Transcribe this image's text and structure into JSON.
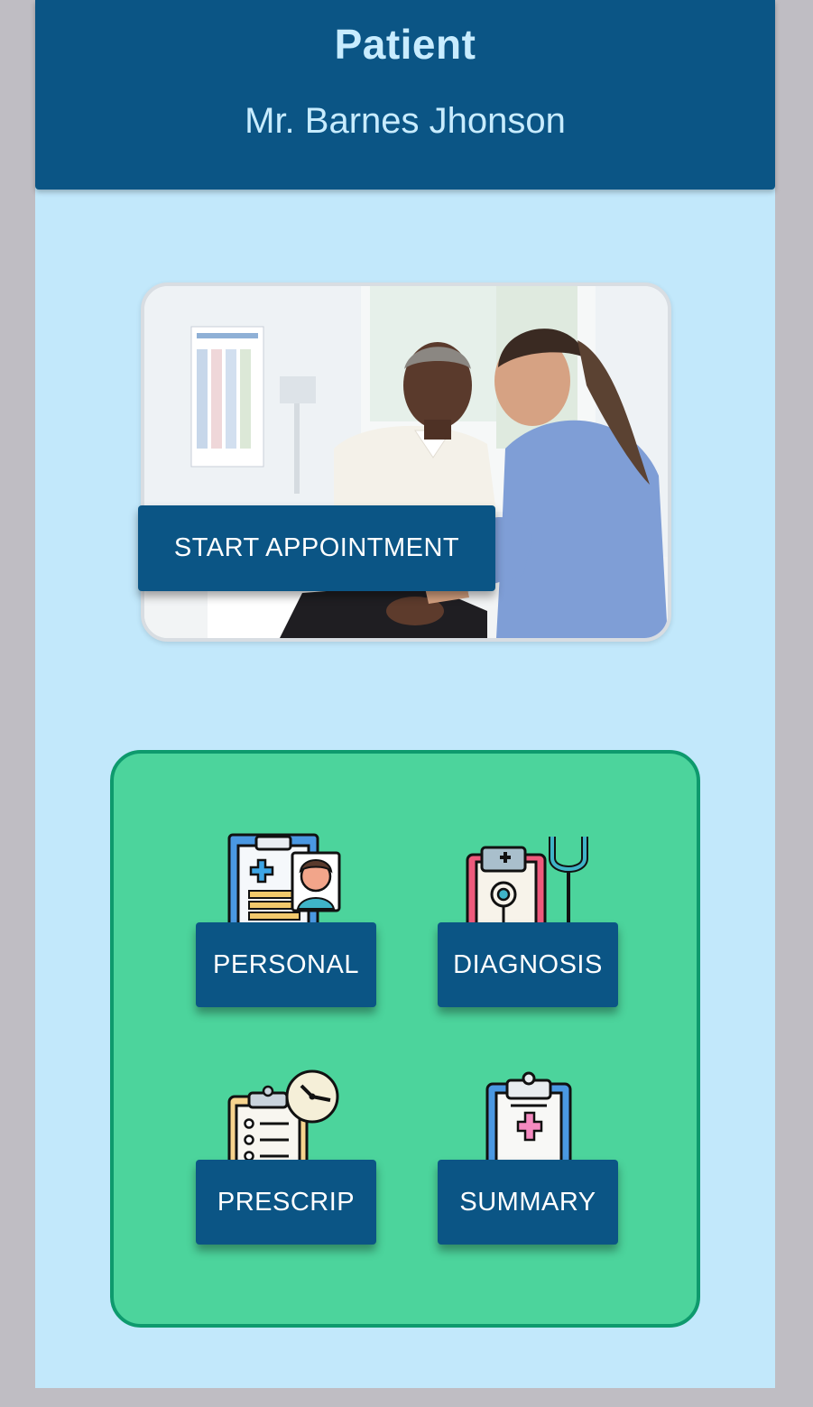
{
  "header": {
    "title": "Patient",
    "patient_name": "Mr. Barnes Jhonson"
  },
  "hero": {
    "image": "doctor-patient-photo",
    "start_label": "START APPOINTMENT"
  },
  "menu": {
    "items": [
      {
        "label": "PERSONAL",
        "icon": "patient-record-icon"
      },
      {
        "label": "DIAGNOSIS",
        "icon": "stethoscope-clipboard-icon"
      },
      {
        "label": "PRESCRIP",
        "icon": "prescription-clock-icon"
      },
      {
        "label": "SUMMARY",
        "icon": "medical-clipboard-icon"
      }
    ]
  },
  "colors": {
    "primary": "#0b5585",
    "background": "#c2e8fb",
    "panel": "#4cd49c",
    "panel_border": "#0e9a6d",
    "header_text": "#c8ecff"
  }
}
